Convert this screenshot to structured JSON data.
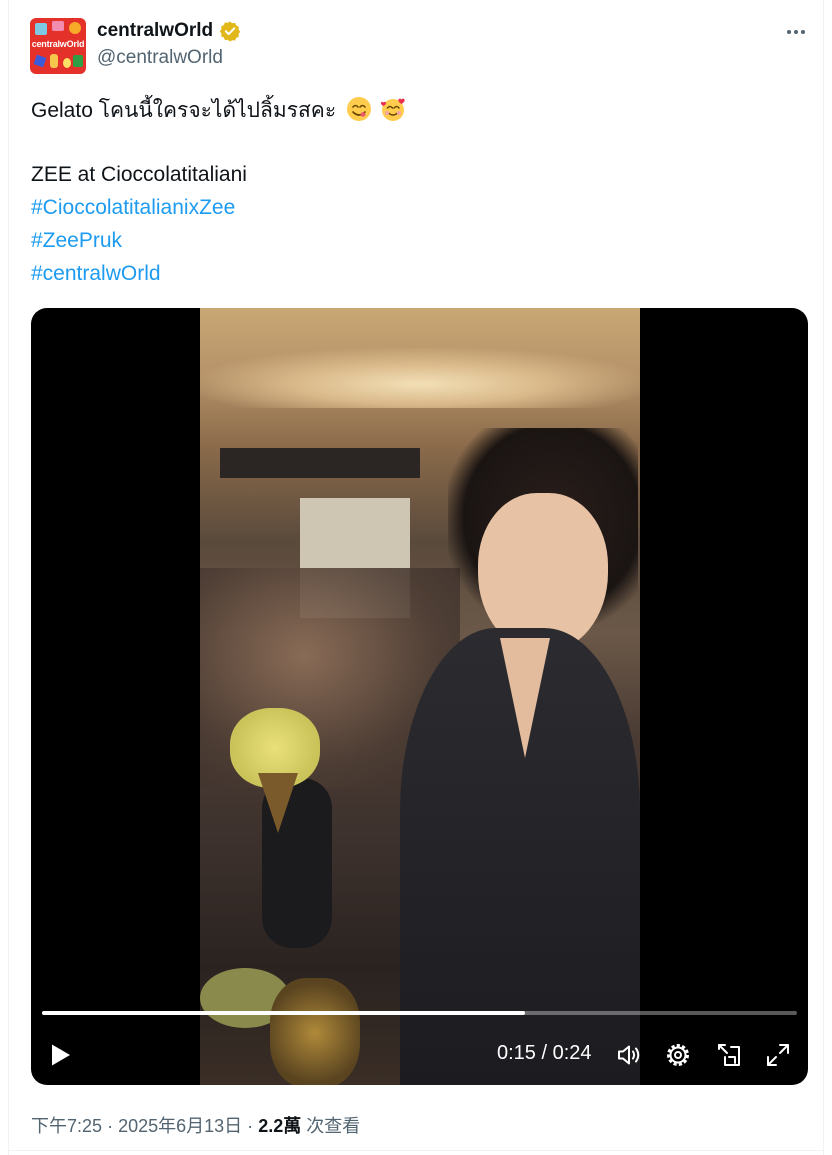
{
  "author": {
    "display_name": "centralwOrld",
    "handle": "@centralwOrld",
    "avatar_text": "centralwOrld",
    "verified": true
  },
  "tweet": {
    "line1": "Gelato โคนนี้ใครจะได้ไปลิ้มรสคะ",
    "emojis": [
      "savoring-face-emoji",
      "smiling-face-with-hearts-emoji"
    ],
    "line2": "ZEE at Cioccolatitaliani",
    "hashtags": [
      "#CioccolatitalianixZee",
      "#ZeePruk",
      "#centralwOrld"
    ]
  },
  "video": {
    "current_time": "0:15",
    "duration": "0:24",
    "progress": 0.64,
    "icons": [
      "play-icon",
      "volume-icon",
      "settings-icon",
      "picture-in-picture-icon",
      "fullscreen-icon"
    ]
  },
  "meta": {
    "time": "下午7:25",
    "date": "2025年6月13日",
    "views_count": "2.2萬",
    "views_label": "次查看",
    "separator": "·"
  },
  "colors": {
    "link": "#1d9bf0",
    "secondary_text": "#536471",
    "primary_text": "#0f1419",
    "verified_badge": "#e2b719",
    "avatar_bg": "#e4322b"
  }
}
